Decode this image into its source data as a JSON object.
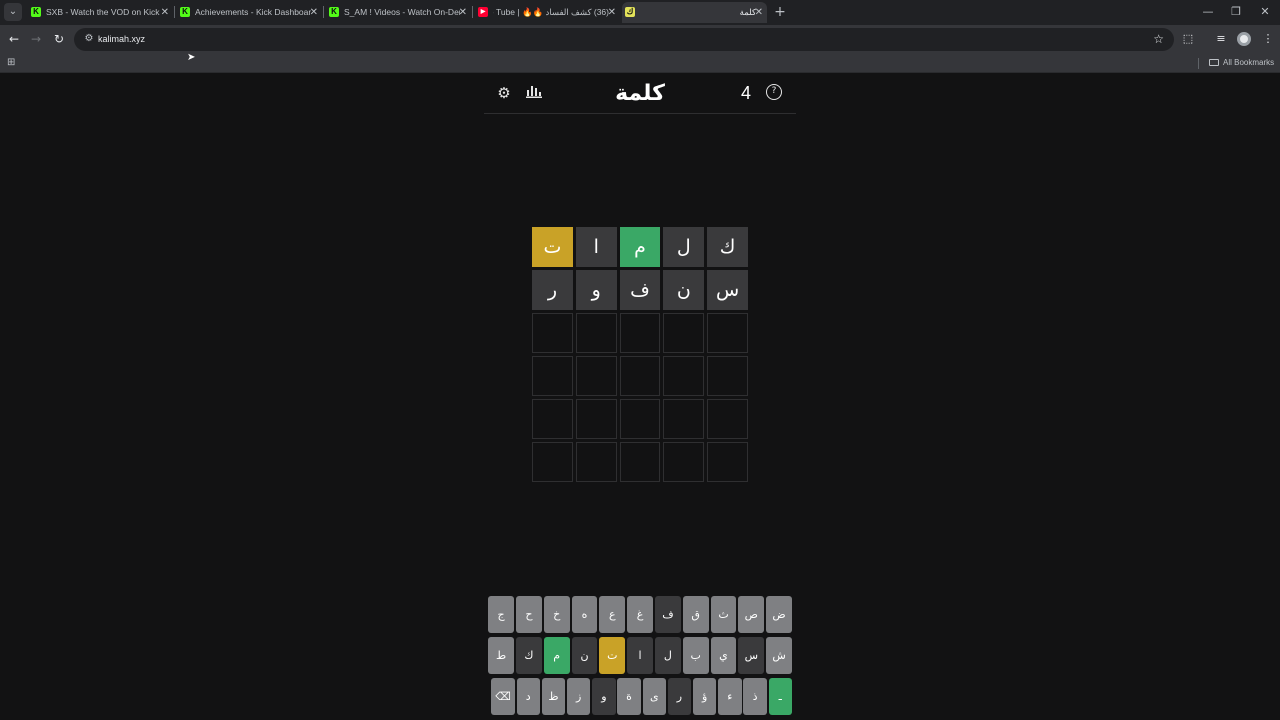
{
  "browser": {
    "tabs": [
      {
        "title": "SXB - Watch the VOD on Kick",
        "favicon": "kick-icon",
        "active": false
      },
      {
        "title": "Achievements - Kick Dashboard",
        "favicon": "kick-icon",
        "active": false
      },
      {
        "title": "S_AM ! Videos - Watch On-Dem",
        "favicon": "kick-icon",
        "active": false
      },
      {
        "title": "(36) كشف الفساد 🔥🔥 | Tube -",
        "favicon": "youtube-icon",
        "active": false
      },
      {
        "title": "كلمة",
        "favicon": "kalimah-icon",
        "active": true
      }
    ],
    "url": "kalimah.xyz",
    "bookmarks_label": "All Bookmarks"
  },
  "game": {
    "title": "كلمة",
    "streak": "4",
    "board": [
      [
        {
          "letter": "ك",
          "state": "absent"
        },
        {
          "letter": "ل",
          "state": "absent"
        },
        {
          "letter": "م",
          "state": "correct"
        },
        {
          "letter": "ا",
          "state": "absent"
        },
        {
          "letter": "ت",
          "state": "present"
        }
      ],
      [
        {
          "letter": "س",
          "state": "absent"
        },
        {
          "letter": "ن",
          "state": "absent"
        },
        {
          "letter": "ف",
          "state": "absent"
        },
        {
          "letter": "و",
          "state": "absent"
        },
        {
          "letter": "ر",
          "state": "absent"
        }
      ],
      [
        {
          "letter": "",
          "state": "empty"
        },
        {
          "letter": "",
          "state": "empty"
        },
        {
          "letter": "",
          "state": "empty"
        },
        {
          "letter": "",
          "state": "empty"
        },
        {
          "letter": "",
          "state": "empty"
        }
      ],
      [
        {
          "letter": "",
          "state": "empty"
        },
        {
          "letter": "",
          "state": "empty"
        },
        {
          "letter": "",
          "state": "empty"
        },
        {
          "letter": "",
          "state": "empty"
        },
        {
          "letter": "",
          "state": "empty"
        }
      ],
      [
        {
          "letter": "",
          "state": "empty"
        },
        {
          "letter": "",
          "state": "empty"
        },
        {
          "letter": "",
          "state": "empty"
        },
        {
          "letter": "",
          "state": "empty"
        },
        {
          "letter": "",
          "state": "empty"
        }
      ],
      [
        {
          "letter": "",
          "state": "empty"
        },
        {
          "letter": "",
          "state": "empty"
        },
        {
          "letter": "",
          "state": "empty"
        },
        {
          "letter": "",
          "state": "empty"
        },
        {
          "letter": "",
          "state": "empty"
        }
      ]
    ],
    "keyboard": [
      [
        {
          "label": "ض",
          "state": "unused"
        },
        {
          "label": "ص",
          "state": "unused"
        },
        {
          "label": "ث",
          "state": "unused"
        },
        {
          "label": "ق",
          "state": "unused"
        },
        {
          "label": "ف",
          "state": "absent"
        },
        {
          "label": "غ",
          "state": "unused"
        },
        {
          "label": "ع",
          "state": "unused"
        },
        {
          "label": "ه",
          "state": "unused"
        },
        {
          "label": "خ",
          "state": "unused"
        },
        {
          "label": "ح",
          "state": "unused"
        },
        {
          "label": "ج",
          "state": "unused"
        }
      ],
      [
        {
          "label": "ش",
          "state": "unused"
        },
        {
          "label": "س",
          "state": "absent"
        },
        {
          "label": "ي",
          "state": "unused"
        },
        {
          "label": "ب",
          "state": "unused"
        },
        {
          "label": "ل",
          "state": "absent"
        },
        {
          "label": "ا",
          "state": "absent"
        },
        {
          "label": "ت",
          "state": "present"
        },
        {
          "label": "ن",
          "state": "absent"
        },
        {
          "label": "م",
          "state": "correct"
        },
        {
          "label": "ك",
          "state": "absent"
        },
        {
          "label": "ط",
          "state": "unused"
        }
      ],
      [
        {
          "label": "ـ",
          "state": "correct",
          "role": "enter"
        },
        {
          "label": "ذ",
          "state": "unused"
        },
        {
          "label": "ء",
          "state": "unused"
        },
        {
          "label": "ؤ",
          "state": "unused"
        },
        {
          "label": "ر",
          "state": "absent"
        },
        {
          "label": "ى",
          "state": "unused"
        },
        {
          "label": "ة",
          "state": "unused"
        },
        {
          "label": "و",
          "state": "absent"
        },
        {
          "label": "ز",
          "state": "unused"
        },
        {
          "label": "ظ",
          "state": "unused"
        },
        {
          "label": "د",
          "state": "unused"
        },
        {
          "label": "⌫",
          "state": "unused",
          "role": "backspace"
        }
      ]
    ]
  },
  "colors": {
    "background": "#121213",
    "absent": "#3a3a3c",
    "present": "#c9a227",
    "correct": "#3aa866",
    "unused_key": "#7f8083"
  }
}
